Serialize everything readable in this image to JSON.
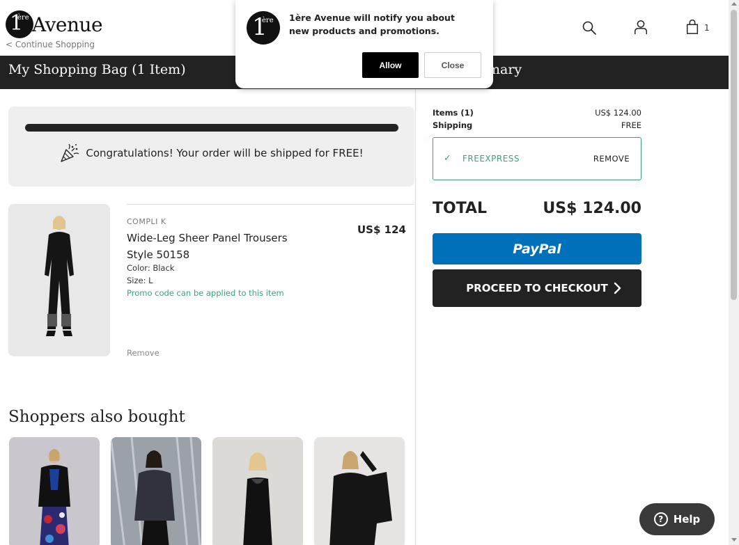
{
  "header": {
    "logo": {
      "one": "1",
      "ere": "ère",
      "word": "Avenue"
    },
    "continue_label": "< Continue Shopping",
    "cart_count": "1",
    "icons": [
      "search-icon",
      "user-icon",
      "shopping-bag-icon"
    ]
  },
  "bar": {
    "title": "My Shopping Bag (1 Item)",
    "summary_fragment": "mary"
  },
  "notification": {
    "message": "1ère Avenue will notify you about new products and promotions.",
    "allow_label": "Allow",
    "close_label": "Close"
  },
  "shipping": {
    "progress": 1.0,
    "message": "Congratulations! Your order will be shipped for FREE!"
  },
  "item": {
    "brand": "COMPLI K",
    "name_line1": "Wide-Leg Sheer Panel Trousers",
    "name_line2": "Style 50158",
    "price": "US$ 124",
    "color": "Color: Black",
    "size": "Size: L",
    "promo": "Promo code can be applied to this item",
    "remove_label": "Remove"
  },
  "also_bought": {
    "title": "Shoppers also bought"
  },
  "summary": {
    "items_label": "Items (1)",
    "items_value": "US$ 124.00",
    "shipping_label": "Shipping",
    "shipping_value": "FREE",
    "coupon_code": "FREEXPRESS",
    "coupon_remove": "REMOVE",
    "total_label": "TOTAL",
    "total_value": "US$ 124.00",
    "paypal_label": "PayPal",
    "checkout_label": "PROCEED TO CHECKOUT"
  },
  "help_label": "Help",
  "colors": {
    "accent_green": "#3aa37a",
    "paypal_blue": "#0070ba",
    "dark": "#222222"
  }
}
